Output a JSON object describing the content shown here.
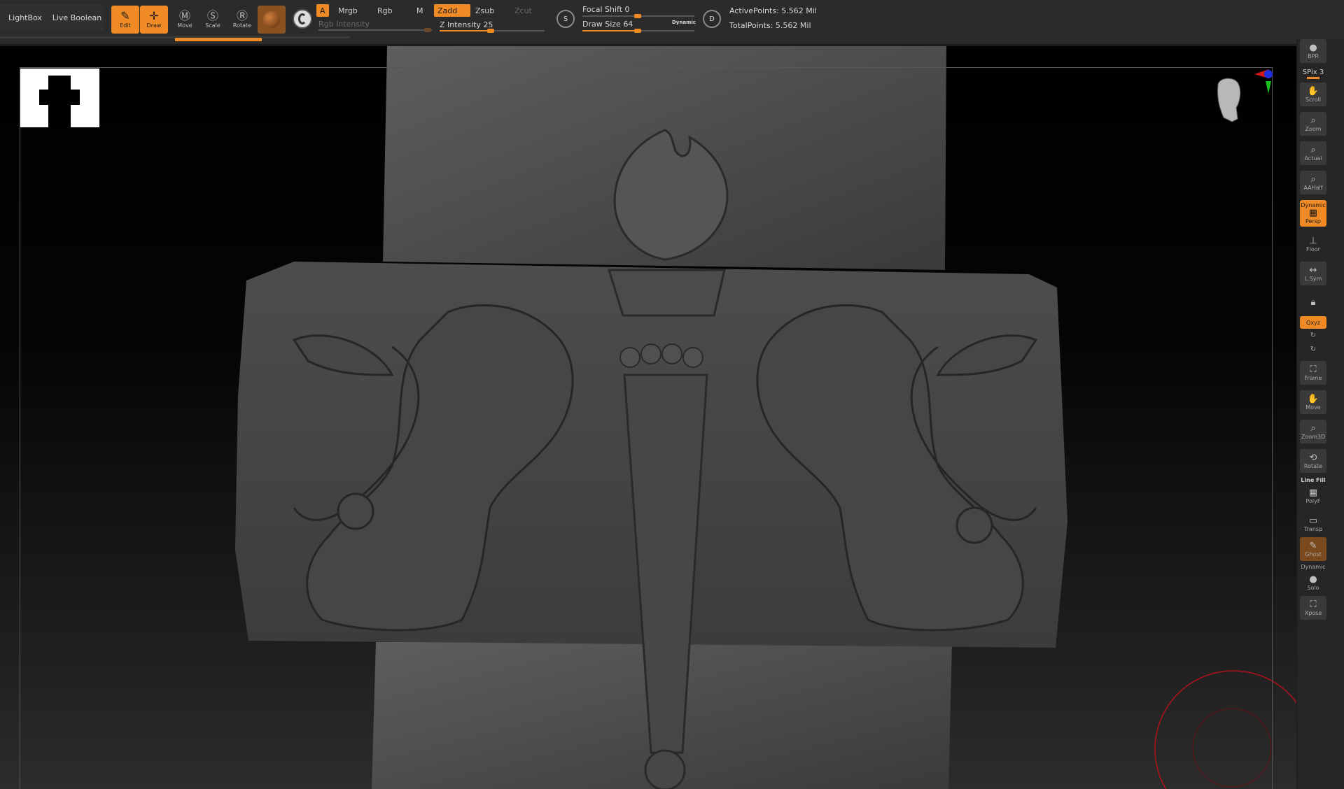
{
  "topbar": {
    "lightbox": "LightBox",
    "live_boolean": "Live Boolean",
    "tools": {
      "edit": "Edit",
      "draw": "Draw",
      "move": "Move",
      "scale": "Scale",
      "rotate": "Rotate"
    },
    "tool_icons": {
      "edit": "edit-icon",
      "draw": "draw-icon",
      "move": "move-icon",
      "scale": "scale-icon",
      "rotate": "rotate-icon"
    },
    "modes": {
      "a": "A",
      "mrgb": "Mrgb",
      "rgb": "Rgb",
      "m": "M",
      "zadd": "Zadd",
      "zsub": "Zsub",
      "zcut": "Zcut"
    },
    "rgb_intensity_label": "Rgb Intensity",
    "z_intensity_label": "Z Intensity",
    "z_intensity_value": "25",
    "focal_shift_label": "Focal Shift",
    "focal_shift_value": "0",
    "draw_size_label": "Draw Size",
    "draw_size_value": "64",
    "dynamic_label": "Dynamic",
    "s_button": "S",
    "d_button": "D",
    "active_points": "ActivePoints: 5.562 Mil",
    "total_points": "TotalPoints: 5.562 Mil",
    "accent_color": "#f08a24"
  },
  "shelf": {
    "bpr": "BPR",
    "spix": "SPix 3",
    "scroll": "Scroll",
    "zoom": "Zoom",
    "actual": "Actual",
    "aahalf": "AAHalf",
    "dynamic": "Dynamic",
    "persp": "Persp",
    "floor": "Floor",
    "lsym": "L.Sym",
    "xyz": "Qxyz",
    "frame": "Frame",
    "move": "Move",
    "zoom3d": "Zoom3D",
    "rotate": "Rotate",
    "line_fill": "Line Fill",
    "polyf": "PolyF",
    "transp": "Transp",
    "ghost": "Ghost",
    "dynamic2": "Dynamic",
    "solo": "Solo",
    "xpose": "Xpose"
  },
  "canvas": {
    "background_color": "#000000",
    "model_color": "#4a4a4a",
    "brush_cursor_color": "#b0121b"
  }
}
